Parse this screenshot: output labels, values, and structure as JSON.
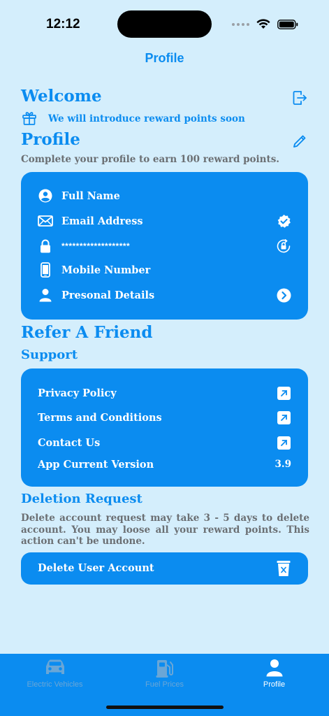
{
  "status": {
    "time": "12:12"
  },
  "nav": {
    "title": "Profile"
  },
  "welcome": {
    "title": "Welcome",
    "reward_note": "We will introduce reward points soon"
  },
  "profile": {
    "title": "Profile",
    "subtitle": "Complete your profile to earn 100 reward points.",
    "items": [
      {
        "label": "Full Name",
        "icon": "person-circle-icon"
      },
      {
        "label": "Email Address",
        "icon": "envelope-icon",
        "right_icon": "verified-badge-icon"
      },
      {
        "label": "*******************",
        "icon": "lock-icon",
        "right_icon": "lock-rotation-icon"
      },
      {
        "label": "Mobile Number",
        "icon": "phone-icon"
      },
      {
        "label": "Presonal Details",
        "icon": "person-icon",
        "right_icon": "chevron-right-circle-icon"
      }
    ]
  },
  "refer": {
    "title": "Refer A Friend"
  },
  "support": {
    "title": "Support",
    "items": [
      {
        "label": "Privacy Policy"
      },
      {
        "label": "Terms and Conditions"
      },
      {
        "label": "Contact Us"
      },
      {
        "label": "App Current Version",
        "value": "3.9"
      }
    ]
  },
  "deletion": {
    "title": "Deletion Request",
    "description": "Delete account request may take 3 - 5 days to delete account. You may loose all your reward points. This action can't be undone.",
    "button_label": "Delete User Account"
  },
  "tabs": [
    {
      "label": "Electric Vehicles",
      "icon": "car-icon",
      "active": false
    },
    {
      "label": "Fuel Prices",
      "icon": "fuel-pump-icon",
      "active": false
    },
    {
      "label": "Profile",
      "icon": "person-icon",
      "active": true
    }
  ],
  "colors": {
    "background": "#d4eefc",
    "accent": "#0b8cf0",
    "muted_text": "#6b6f73",
    "inactive_tab": "#6aa6d6"
  }
}
